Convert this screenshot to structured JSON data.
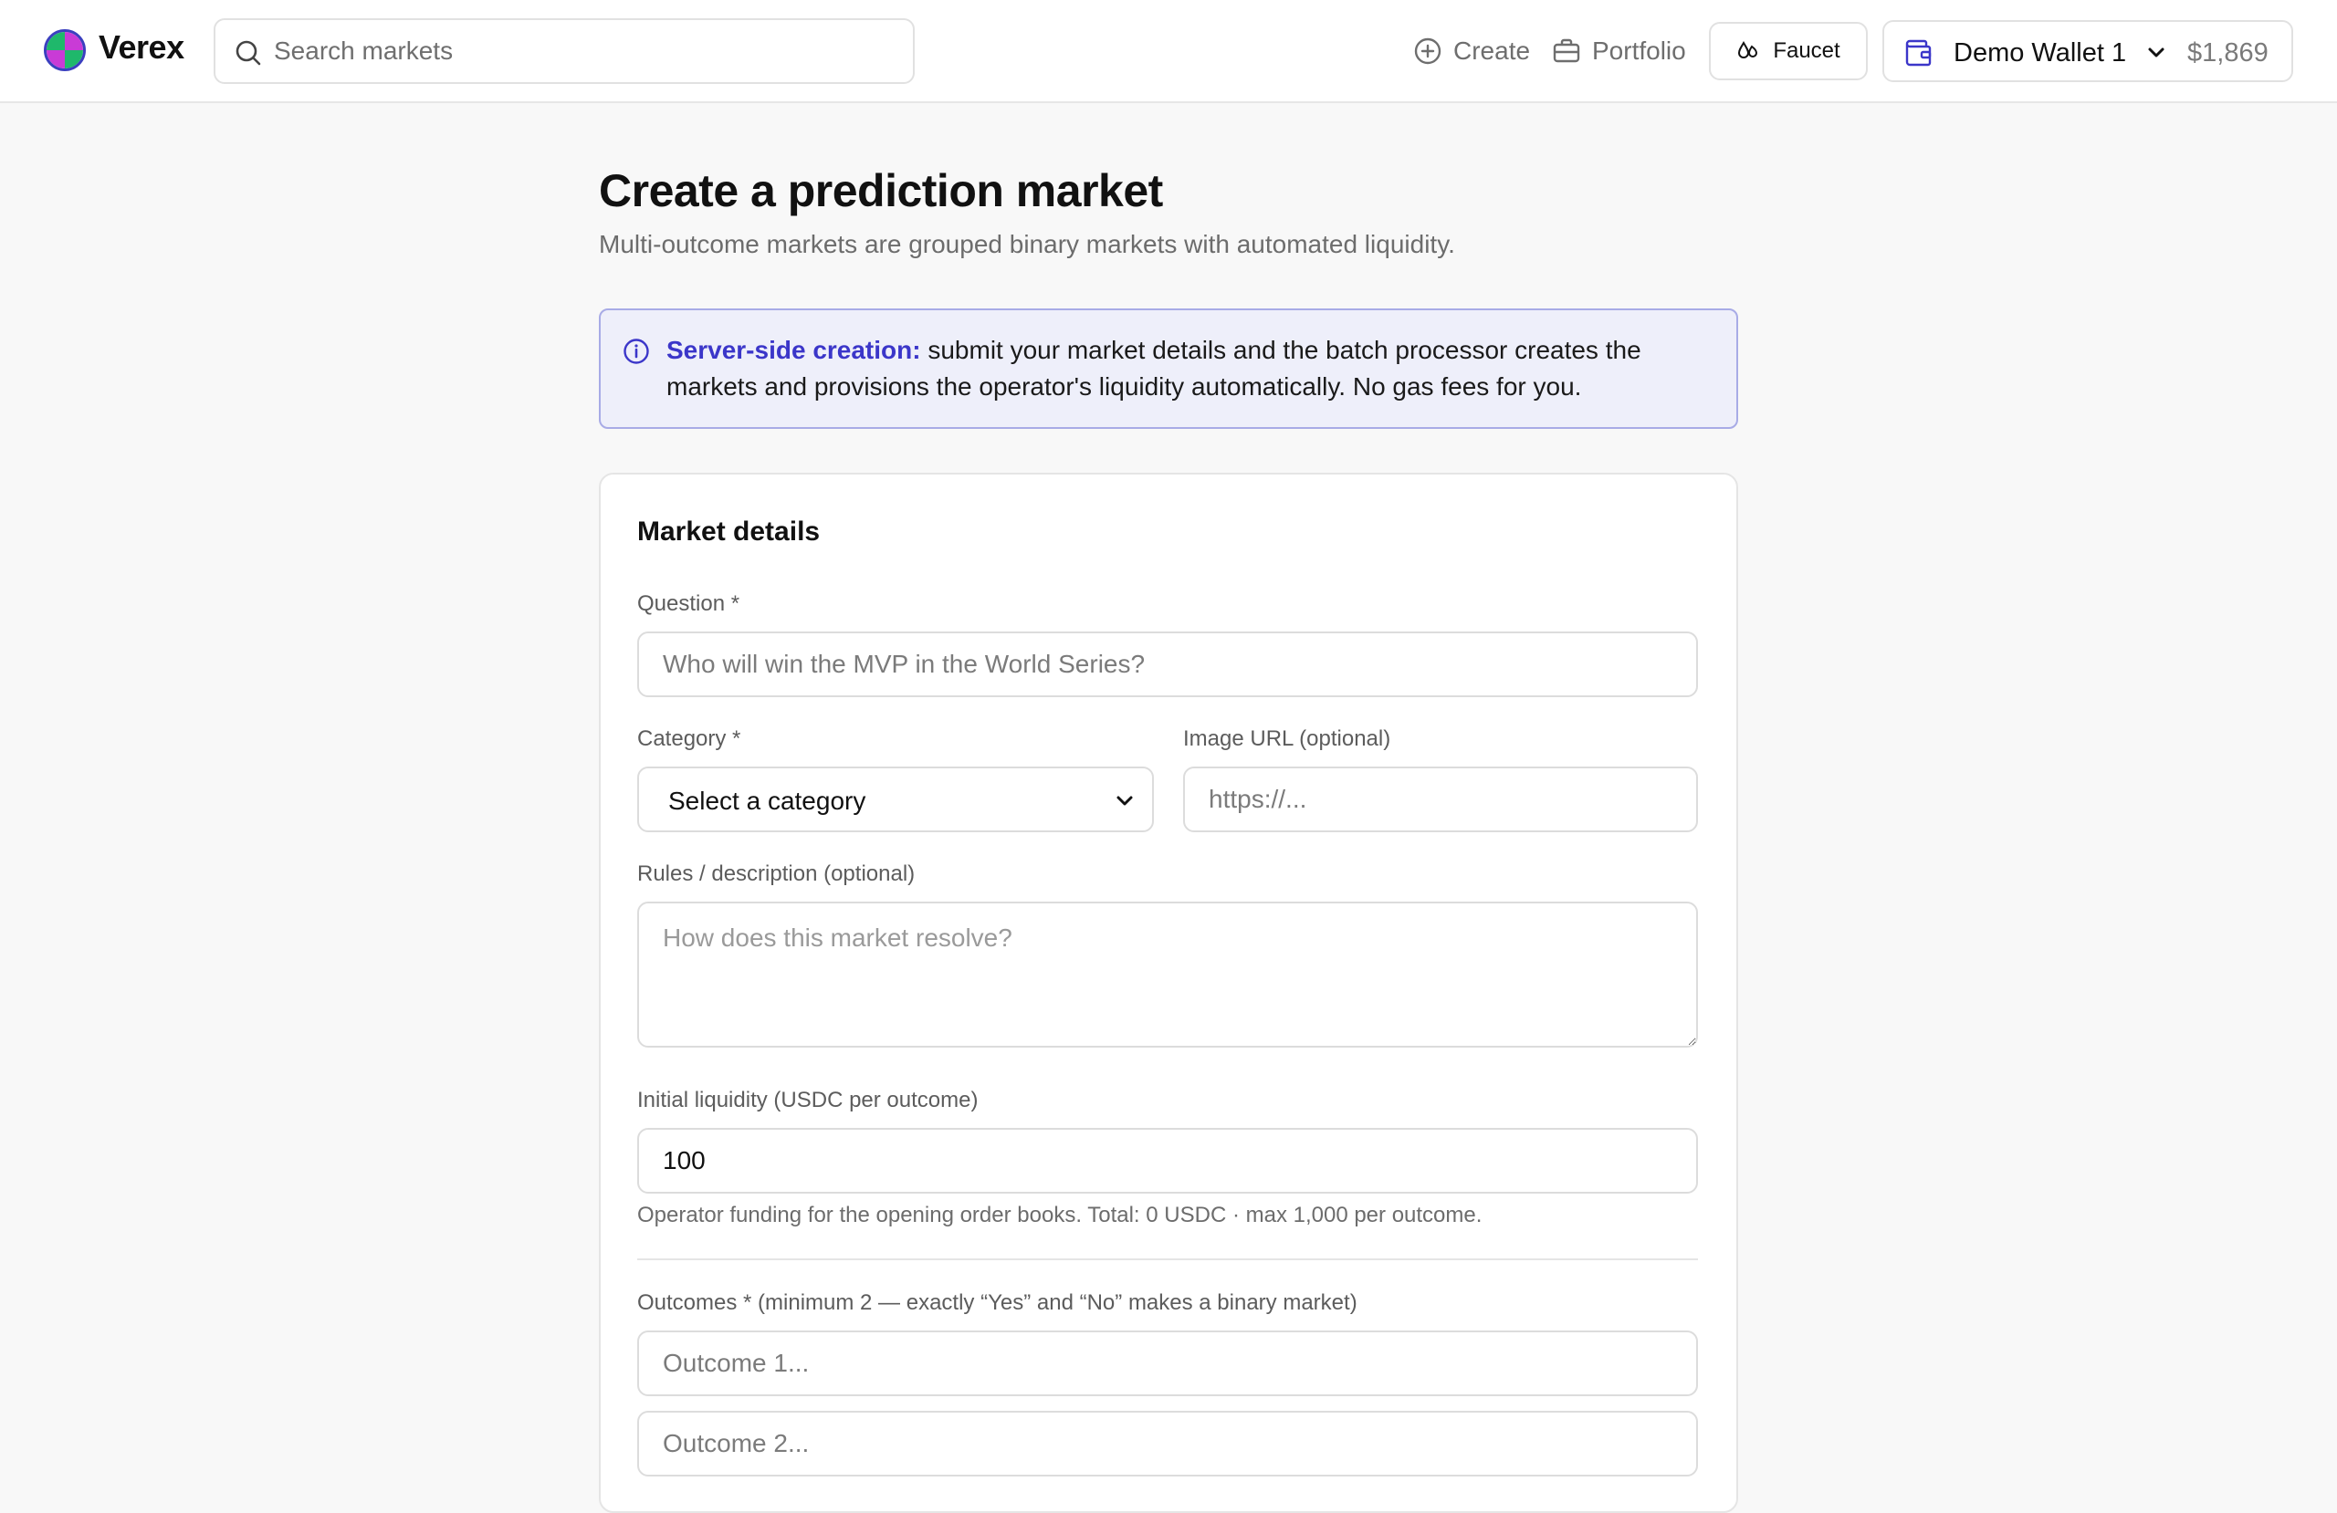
{
  "header": {
    "brand": "Verex",
    "search_placeholder": "Search markets",
    "nav": {
      "create": "Create",
      "portfolio": "Portfolio"
    },
    "faucet_label": "Faucet",
    "wallet": {
      "name": "Demo Wallet 1",
      "balance": "$1,869"
    }
  },
  "page": {
    "title": "Create a prediction market",
    "subtitle": "Multi-outcome markets are grouped binary markets with automated liquidity."
  },
  "info_banner": {
    "strong": "Server-side creation:",
    "text": " submit your market details and the batch processor creates the markets and provisions the operator's liquidity automatically. No gas fees for you."
  },
  "form": {
    "section_title": "Market details",
    "question": {
      "label": "Question *",
      "placeholder": "Who will win the MVP in the World Series?"
    },
    "category": {
      "label": "Category *",
      "selected": "Select a category"
    },
    "image_url": {
      "label": "Image URL (optional)",
      "placeholder": "https://..."
    },
    "rules": {
      "label": "Rules / description (optional)",
      "placeholder": "How does this market resolve?"
    },
    "liquidity": {
      "label": "Initial liquidity (USDC per outcome)",
      "value": "100",
      "hint": "Operator funding for the opening order books. Total: 0 USDC · max 1,000 per outcome."
    },
    "outcomes": {
      "label": "Outcomes * (minimum 2 — exactly “Yes” and “No” makes a binary market)",
      "items": [
        {
          "placeholder": "Outcome 1..."
        },
        {
          "placeholder": "Outcome 2..."
        }
      ]
    }
  },
  "colors": {
    "accent": "#3b36c9",
    "info_bg": "#eeeffa",
    "info_border": "#a8abe6"
  },
  "icons": {
    "logo": "verex-logo-icon",
    "search": "search-icon",
    "create": "plus-circle-icon",
    "portfolio": "briefcase-icon",
    "faucet": "droplets-icon",
    "wallet": "wallet-icon",
    "info": "info-icon"
  }
}
